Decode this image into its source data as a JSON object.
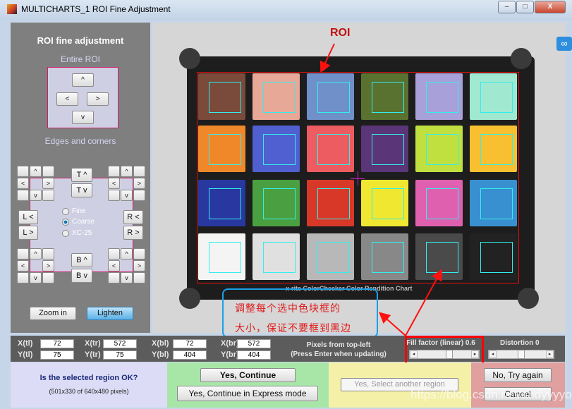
{
  "window": {
    "title": "MULTICHARTS_1 ROI Fine Adjustment",
    "minimize": "–",
    "maximize": "□",
    "close": "X"
  },
  "left_panel": {
    "title": "ROI fine adjustment",
    "entire_roi_label": "Entire ROI",
    "entire_buttons": {
      "up": "^",
      "left": "<",
      "right": ">",
      "down": "v"
    },
    "edges_label": "Edges and corners",
    "corner_buttons": {
      "up": "^",
      "left": "<",
      "right": ">",
      "down": "v"
    },
    "edge_buttons": {
      "top_up": "T ^",
      "top_down": "T v",
      "left_left": "L <",
      "left_right": "L >",
      "right_left": "R <",
      "right_right": "R >",
      "bottom_up": "B ^",
      "bottom_down": "B v"
    },
    "step_options": [
      {
        "label": "Fine",
        "selected": false
      },
      {
        "label": "Coarse",
        "selected": true
      },
      {
        "label": "XC-25",
        "selected": false
      }
    ],
    "zoom_in": "Zoom in",
    "lighten": "Lighten"
  },
  "image": {
    "roi_label": "ROI",
    "chart_caption": "x-rite ColorChecker Color Rendition Chart",
    "patch_colors": [
      "#7a4a3a",
      "#e8a898",
      "#6f90c8",
      "#5a7230",
      "#a8a0d8",
      "#a0e8d0",
      "#f0882a",
      "#5060d0",
      "#ec5c60",
      "#5a3678",
      "#c0e040",
      "#f8c030",
      "#2838a0",
      "#4aa040",
      "#d83828",
      "#f0e830",
      "#e060b0",
      "#3890d0",
      "#f4f4f4",
      "#e0e0e0",
      "#b8b8b8",
      "#888888",
      "#4a4a4a",
      "#222222"
    ],
    "roi_color": "#e01010",
    "inner_box_color": "#33eeee",
    "annotation": [
      "调整每个选中色块框的",
      "大小，保证不要框到黑边"
    ]
  },
  "coords": {
    "x_tl_label": "X(tl)",
    "x_tl": "72",
    "y_tl_label": "Y(tl)",
    "y_tl": "75",
    "x_tr_label": "X(tr)",
    "x_tr": "572",
    "y_tr_label": "Y(tr)",
    "y_tr": "75",
    "x_bl_label": "X(bl)",
    "x_bl": "72",
    "y_bl_label": "Y(bl)",
    "y_bl": "404",
    "x_br_label": "X(br)",
    "x_br": "572",
    "y_br_label": "Y(br)",
    "y_br": "404",
    "hint1": "Pixels from top-left",
    "hint2": "(Press Enter when updating)"
  },
  "fill_factor": {
    "label": "Fill factor (linear) 0.6",
    "value": 0.6
  },
  "distortion": {
    "label": "Distortion 0",
    "value": 0
  },
  "confirm": {
    "question": "Is the selected region OK?",
    "size_info": "(501x330 of 640x480 pixels)",
    "yes_continue": "Yes, Continue",
    "yes_express": "Yes, Continue in Express mode",
    "yes_another": "Yes, Select another region",
    "no_try": "No, Try again",
    "cancel": "Cancel"
  },
  "watermark": "https://blog.csdn.net/andyyyyoo"
}
